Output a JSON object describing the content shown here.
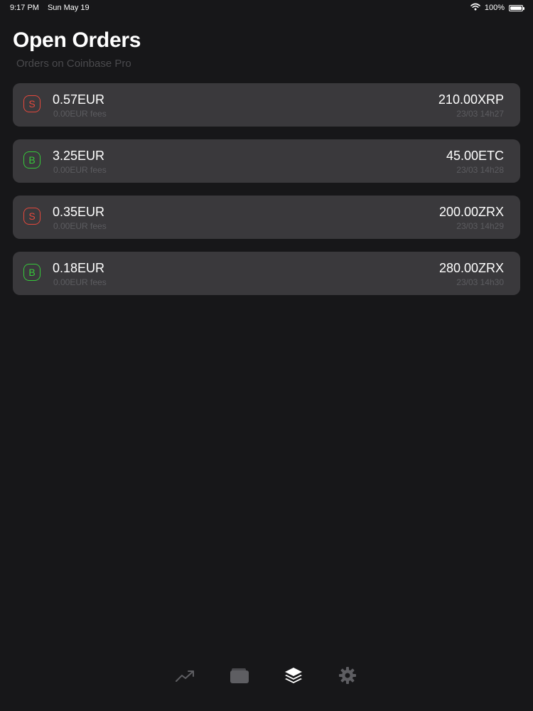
{
  "status_bar": {
    "time": "9:17 PM",
    "date": "Sun May 19",
    "battery": "100%"
  },
  "header": {
    "title": "Open Orders",
    "subtitle": "Orders on Coinbase Pro"
  },
  "orders": [
    {
      "side": "S",
      "amount": "0.57EUR",
      "fees": "0.00EUR fees",
      "volume": "210.00XRP",
      "time": "23/03 14h27"
    },
    {
      "side": "B",
      "amount": "3.25EUR",
      "fees": "0.00EUR fees",
      "volume": "45.00ETC",
      "time": "23/03 14h28"
    },
    {
      "side": "S",
      "amount": "0.35EUR",
      "fees": "0.00EUR fees",
      "volume": "200.00ZRX",
      "time": "23/03 14h29"
    },
    {
      "side": "B",
      "amount": "0.18EUR",
      "fees": "0.00EUR fees",
      "volume": "280.00ZRX",
      "time": "23/03 14h30"
    }
  ],
  "tabs": [
    {
      "icon": "trending-up-icon",
      "active": false
    },
    {
      "icon": "wallet-icon",
      "active": false
    },
    {
      "icon": "layers-icon",
      "active": true
    },
    {
      "icon": "gear-icon",
      "active": false
    }
  ],
  "colors": {
    "background": "#171719",
    "card": "#3a393c",
    "sell": "#e5483c",
    "buy": "#36c93a",
    "tab_inactive": "#5e5e62",
    "tab_active": "#ffffff"
  }
}
